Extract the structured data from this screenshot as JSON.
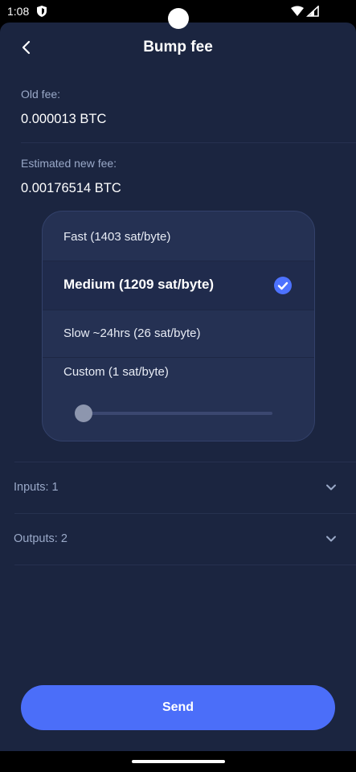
{
  "status_bar": {
    "time": "1:08"
  },
  "header": {
    "title": "Bump fee"
  },
  "old_fee": {
    "label": "Old fee:",
    "value": "0.000013 BTC"
  },
  "new_fee": {
    "label": "Estimated new fee:",
    "value": "0.00176514 BTC"
  },
  "fee_options": [
    {
      "label": "Fast (1403 sat/byte)",
      "selected": false
    },
    {
      "label": "Medium (1209 sat/byte)",
      "selected": true
    },
    {
      "label": "Slow ~24hrs (26 sat/byte)",
      "selected": false
    },
    {
      "label": "Custom (1 sat/byte)",
      "selected": false
    }
  ],
  "custom_slider": {
    "value": 1
  },
  "inputs": {
    "label": "Inputs: 1"
  },
  "outputs": {
    "label": "Outputs: 2"
  },
  "send": {
    "label": "Send"
  },
  "colors": {
    "background": "#1b2540",
    "accent": "#4b6ef9",
    "card": "#253153"
  }
}
